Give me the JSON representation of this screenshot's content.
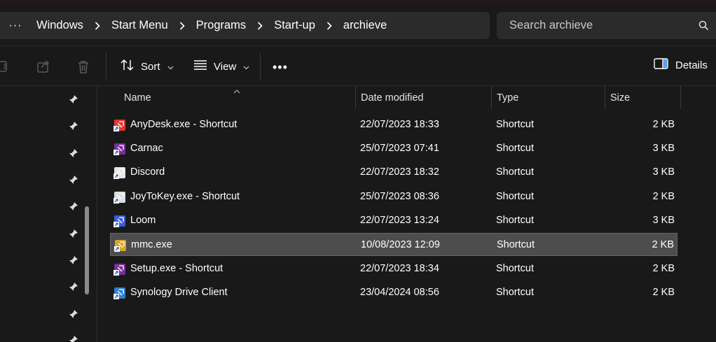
{
  "breadcrumb": {
    "more": "···",
    "items": [
      "Windows",
      "Start Menu",
      "Programs",
      "Start-up",
      "archieve"
    ]
  },
  "search": {
    "placeholder": "Search archieve"
  },
  "toolbar": {
    "sort_label": "Sort",
    "view_label": "View",
    "more": "•••",
    "details_label": "Details"
  },
  "columns": {
    "name": "Name",
    "date": "Date modified",
    "type": "Type",
    "size": "Size"
  },
  "files": [
    {
      "name": "AnyDesk.exe - Shortcut",
      "date": "22/07/2023 18:33",
      "type": "Shortcut",
      "size": "2 KB",
      "icon": "anydesk-icon",
      "color": "#e8352c"
    },
    {
      "name": "Carnac",
      "date": "25/07/2023 07:41",
      "type": "Shortcut",
      "size": "3 KB",
      "icon": "carnac-icon",
      "color": "#7a2e9c"
    },
    {
      "name": "Discord",
      "date": "22/07/2023 18:32",
      "type": "Shortcut",
      "size": "3 KB",
      "icon": "discord-icon",
      "color": "#e6e6e6"
    },
    {
      "name": "JoyToKey.exe - Shortcut",
      "date": "25/07/2023 08:36",
      "type": "Shortcut",
      "size": "2 KB",
      "icon": "joytokey-icon",
      "color": "#dddddd"
    },
    {
      "name": "Loom",
      "date": "22/07/2023 13:24",
      "type": "Shortcut",
      "size": "3 KB",
      "icon": "loom-icon",
      "color": "#3b5bdb"
    },
    {
      "name": "mmc.exe",
      "date": "10/08/2023 12:09",
      "type": "Shortcut",
      "size": "2 KB",
      "icon": "mmc-icon",
      "color": "#d9a52b",
      "selected": true
    },
    {
      "name": "Setup.exe - Shortcut",
      "date": "22/07/2023 18:34",
      "type": "Shortcut",
      "size": "2 KB",
      "icon": "setup-icon",
      "color": "#7a2e9c"
    },
    {
      "name": "Synology Drive Client",
      "date": "23/04/2024 08:56",
      "type": "Shortcut",
      "size": "2 KB",
      "icon": "synology-icon",
      "color": "#2d7fd3"
    }
  ],
  "colors": {
    "background": "#191919",
    "bar": "#2b2b2b",
    "selection": "#4d4d4d"
  }
}
